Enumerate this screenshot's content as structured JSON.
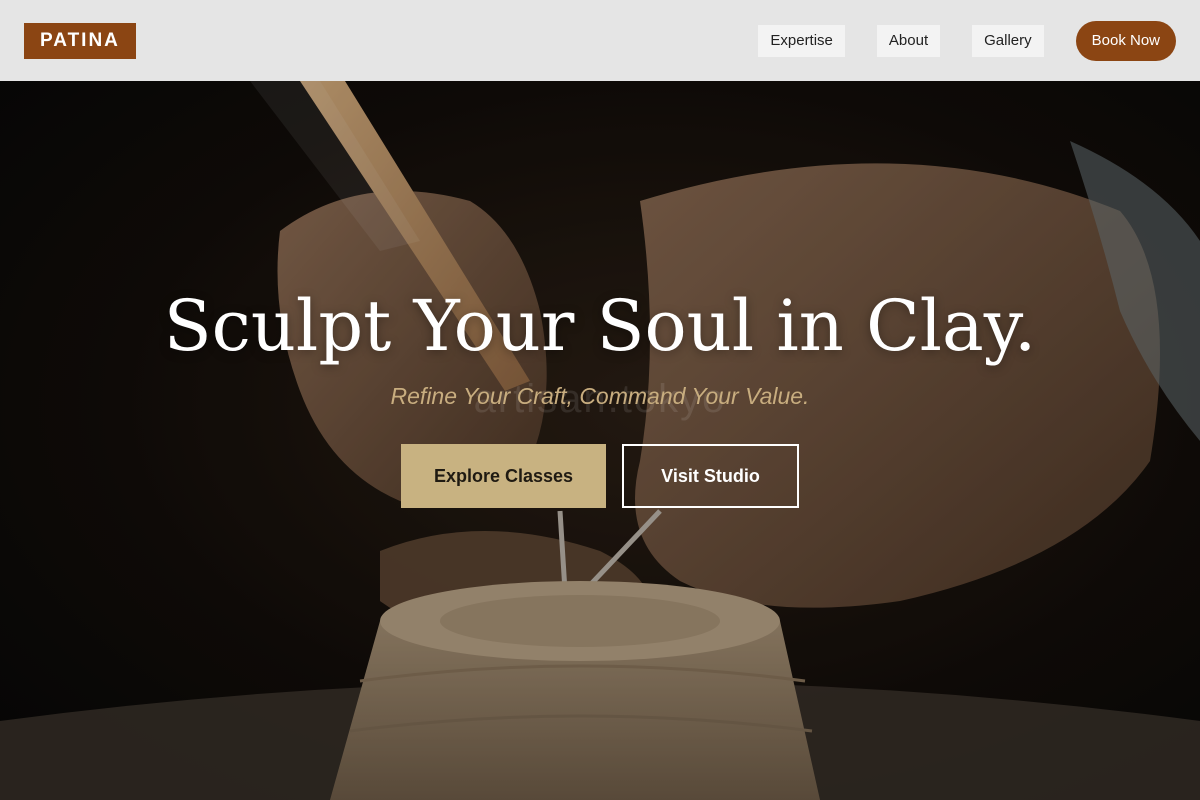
{
  "header": {
    "logo": "PATINA",
    "nav": [
      {
        "label": "Expertise"
      },
      {
        "label": "About"
      },
      {
        "label": "Gallery"
      }
    ],
    "cta_label": "Book Now"
  },
  "hero": {
    "title": "Sculpt Your Soul in Clay.",
    "subtitle": "Refine Your Craft, Command Your Value.",
    "watermark": "artisan.tokyo",
    "primary_button": "Explore Classes",
    "secondary_button": "Visit Studio",
    "image_alt": "Hands carving a clay pot with a wooden tool and wire loop"
  },
  "colors": {
    "brand": "#8b4513",
    "header_bg": "#e5e5e5",
    "accent_gold": "#c8b281",
    "subtitle_gold": "#c8ad7f"
  },
  "icons": {
    "logo": "patina-wordmark"
  }
}
